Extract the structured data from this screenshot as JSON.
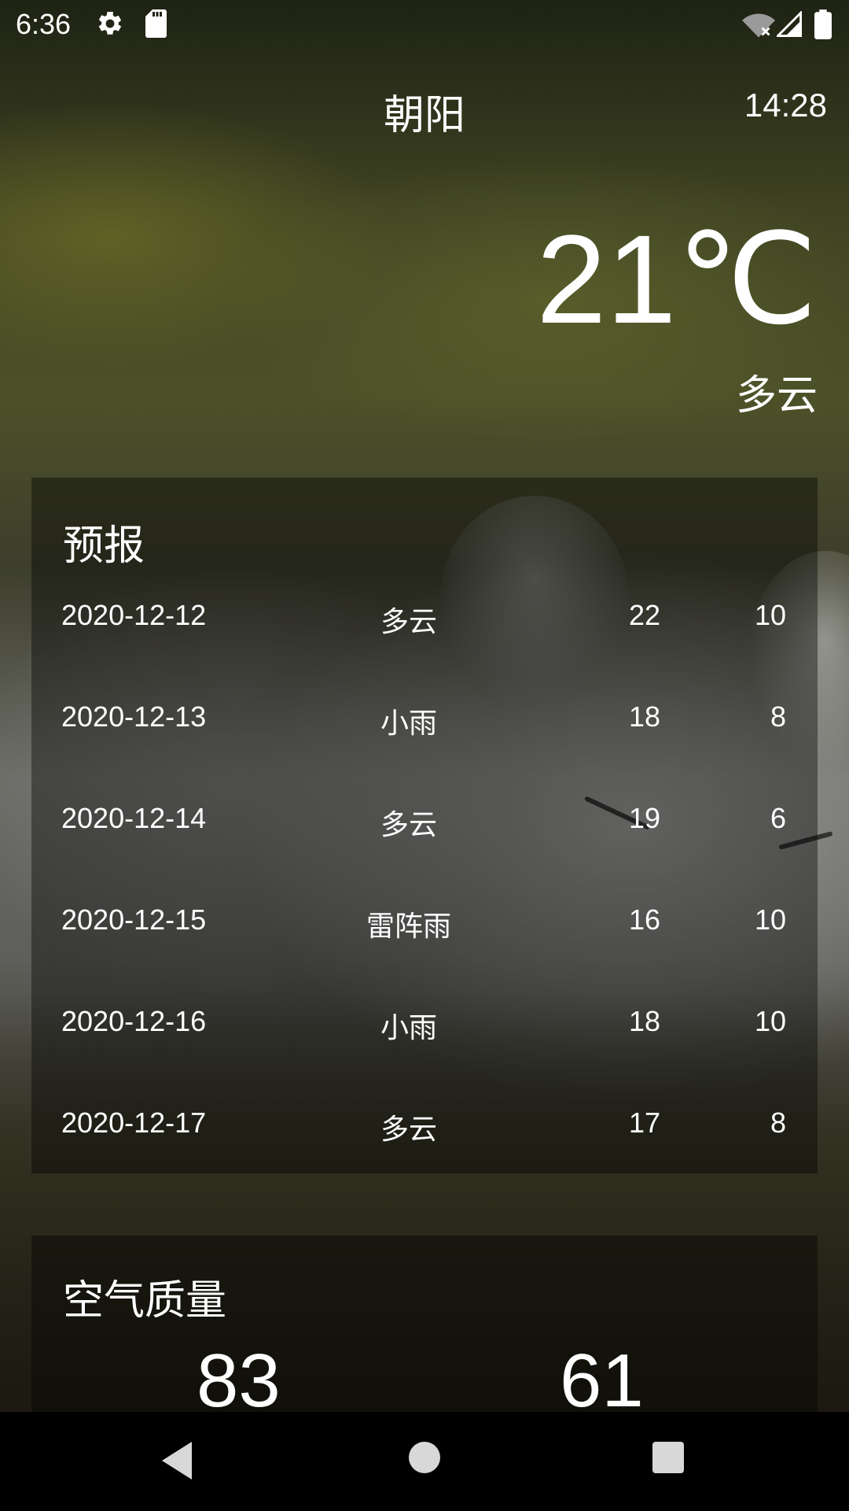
{
  "status_bar": {
    "time": "6:36",
    "icons": [
      "gear-icon",
      "sd-card-icon",
      "wifi-off-icon",
      "signal-icon",
      "battery-icon"
    ]
  },
  "header": {
    "city": "朝阳",
    "update_time": "14:28"
  },
  "now": {
    "temperature": "21℃",
    "condition": "多云"
  },
  "forecast": {
    "title": "预报",
    "rows": [
      {
        "date": "2020-12-12",
        "cond": "多云",
        "max": "22",
        "min": "10"
      },
      {
        "date": "2020-12-13",
        "cond": "小雨",
        "max": "18",
        "min": "8"
      },
      {
        "date": "2020-12-14",
        "cond": "多云",
        "max": "19",
        "min": "6"
      },
      {
        "date": "2020-12-15",
        "cond": "雷阵雨",
        "max": "16",
        "min": "10"
      },
      {
        "date": "2020-12-16",
        "cond": "小雨",
        "max": "18",
        "min": "10"
      },
      {
        "date": "2020-12-17",
        "cond": "多云",
        "max": "17",
        "min": "8"
      }
    ]
  },
  "air_quality": {
    "title": "空气质量",
    "aqi": "83",
    "pm25": "61"
  },
  "colors": {
    "card_bg": "rgba(0,0,0,0.38)",
    "text": "#ffffff",
    "nav_bg": "#000000"
  }
}
